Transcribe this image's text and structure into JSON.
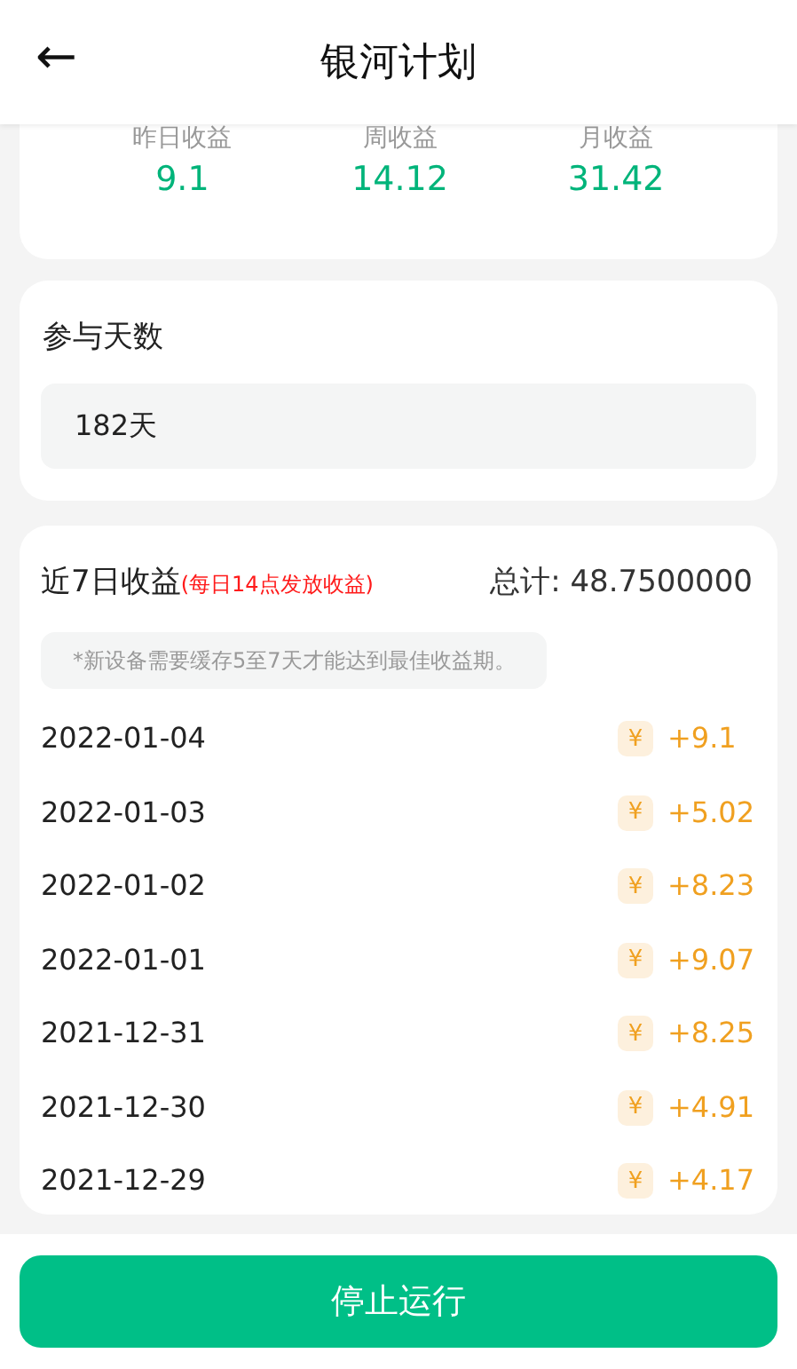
{
  "header": {
    "back_icon": "←",
    "title": "银河计划"
  },
  "stats": [
    {
      "label": "昨日收益",
      "value": "9.1"
    },
    {
      "label": "周收益",
      "value": "14.12"
    },
    {
      "label": "月收益",
      "value": "31.42"
    }
  ],
  "days": {
    "label": "参与天数",
    "value": "182天"
  },
  "earnings": {
    "title": "近7日收益",
    "note": "(每日14点发放收益)",
    "total": "总计: 48.7500000",
    "tip": "*新设备需要缓存5至7天才能达到最佳收益期。",
    "rows": [
      {
        "date": "2022-01-04",
        "currency": "¥",
        "amount": "+9.1"
      },
      {
        "date": "2022-01-03",
        "currency": "¥",
        "amount": "+5.02"
      },
      {
        "date": "2022-01-02",
        "currency": "¥",
        "amount": "+8.23"
      },
      {
        "date": "2022-01-01",
        "currency": "¥",
        "amount": "+9.07"
      },
      {
        "date": "2021-12-31",
        "currency": "¥",
        "amount": "+8.25"
      },
      {
        "date": "2021-12-30",
        "currency": "¥",
        "amount": "+4.91"
      },
      {
        "date": "2021-12-29",
        "currency": "¥",
        "amount": "+4.17"
      }
    ]
  },
  "stop_button": "停止运行"
}
